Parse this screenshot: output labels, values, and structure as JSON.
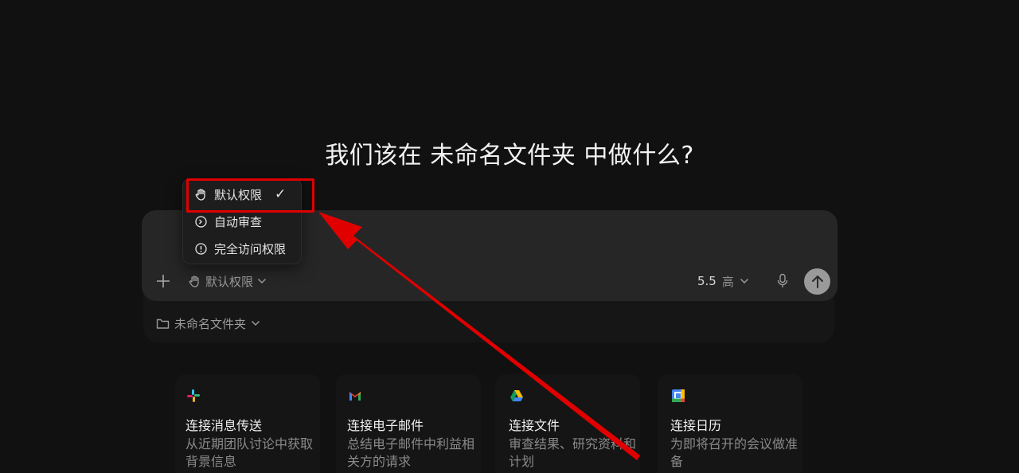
{
  "heading": "我们该在 未命名文件夹 中做什么?",
  "composer": {
    "permission_label": "默认权限",
    "model_version": "5.5",
    "model_effort": "高"
  },
  "folder": {
    "label": "未命名文件夹"
  },
  "permission_menu": {
    "items": [
      {
        "label": "默认权限",
        "icon": "hand-icon",
        "selected": true
      },
      {
        "label": "自动审查",
        "icon": "auto-review-icon",
        "selected": false
      },
      {
        "label": "完全访问权限",
        "icon": "alert-icon",
        "selected": false
      }
    ]
  },
  "cards": [
    {
      "title": "连接消息传送",
      "desc": "从近期团队讨论中获取背景信息",
      "icon": "slack-icon"
    },
    {
      "title": "连接电子邮件",
      "desc": "总结电子邮件中利益相关方的请求",
      "icon": "gmail-icon"
    },
    {
      "title": "连接文件",
      "desc": "审查结果、研究资料和计划",
      "icon": "drive-icon"
    },
    {
      "title": "连接日历",
      "desc": "为即将召开的会议做准备",
      "icon": "calendar-icon"
    }
  ],
  "colors": {
    "background": "#111111",
    "composer": "#262626",
    "annotation": "#e00000"
  }
}
